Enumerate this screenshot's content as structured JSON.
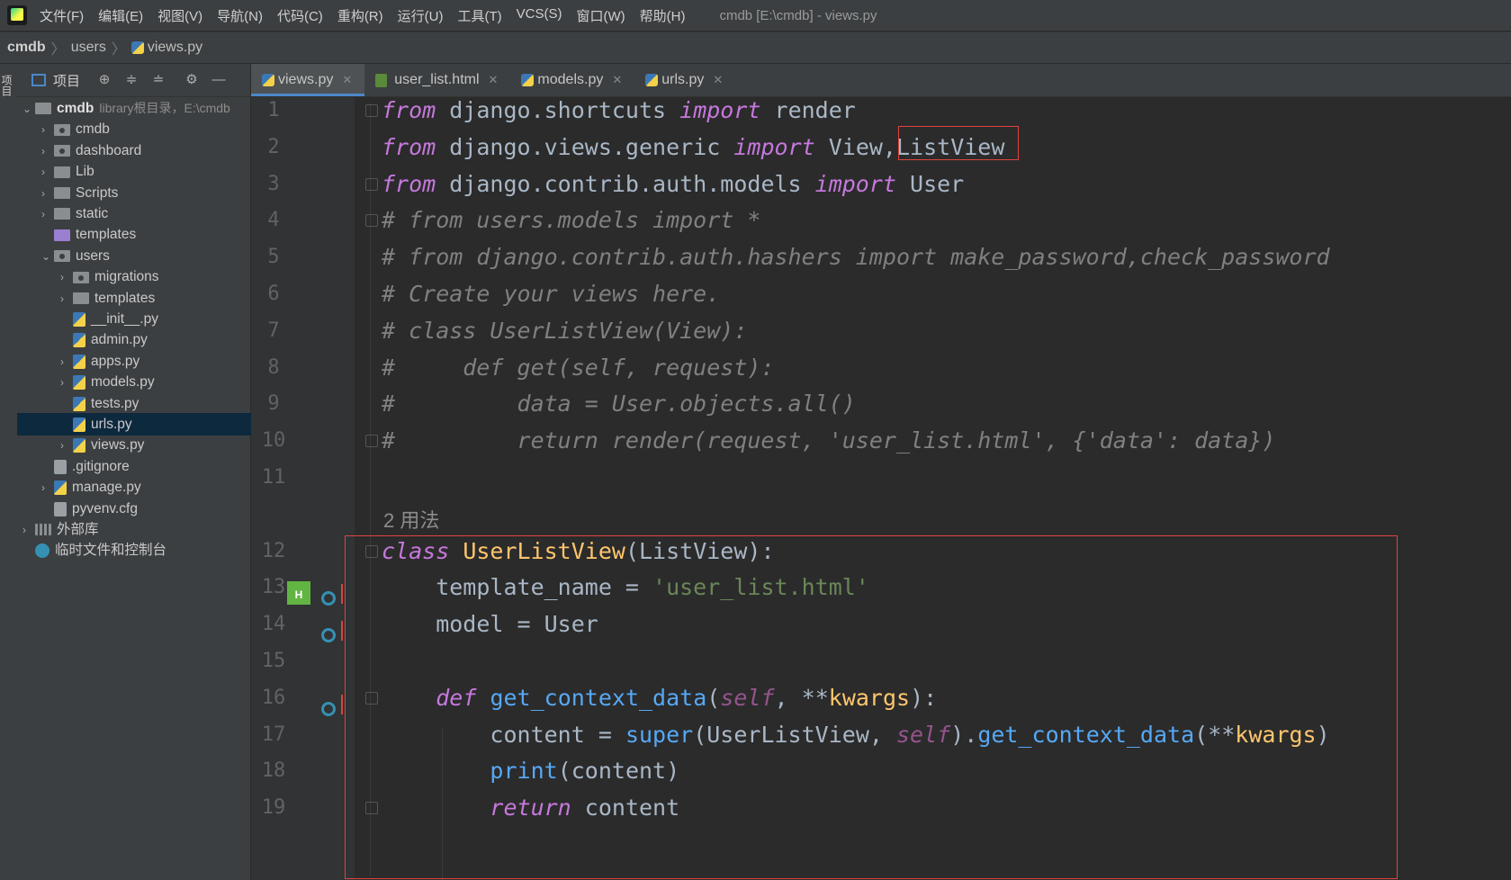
{
  "menubar": {
    "items": [
      "文件(F)",
      "编辑(E)",
      "视图(V)",
      "导航(N)",
      "代码(C)",
      "重构(R)",
      "运行(U)",
      "工具(T)",
      "VCS(S)",
      "窗口(W)",
      "帮助(H)"
    ],
    "window_title": "cmdb [E:\\cmdb] - views.py"
  },
  "breadcrumb": [
    "cmdb",
    "users",
    "views.py"
  ],
  "left_strip_label": "项目",
  "project_panel": {
    "title": "项目",
    "tree": [
      {
        "label": "cmdb",
        "extra": "library根目录，E:\\cmdb",
        "indent": 0,
        "arrow": "open",
        "icon": "folder"
      },
      {
        "label": "cmdb",
        "indent": 1,
        "arrow": "closed",
        "icon": "folder-mod"
      },
      {
        "label": "dashboard",
        "indent": 1,
        "arrow": "closed",
        "icon": "folder-mod"
      },
      {
        "label": "Lib",
        "indent": 1,
        "arrow": "closed",
        "icon": "folder"
      },
      {
        "label": "Scripts",
        "indent": 1,
        "arrow": "closed",
        "icon": "folder"
      },
      {
        "label": "static",
        "indent": 1,
        "arrow": "closed",
        "icon": "folder"
      },
      {
        "label": "templates",
        "indent": 1,
        "arrow": "none",
        "icon": "folder-purple"
      },
      {
        "label": "users",
        "indent": 1,
        "arrow": "open",
        "icon": "folder-mod"
      },
      {
        "label": "migrations",
        "indent": 2,
        "arrow": "closed",
        "icon": "folder-mod"
      },
      {
        "label": "templates",
        "indent": 2,
        "arrow": "closed",
        "icon": "folder"
      },
      {
        "label": "__init__.py",
        "indent": 2,
        "arrow": "none",
        "icon": "py"
      },
      {
        "label": "admin.py",
        "indent": 2,
        "arrow": "none",
        "icon": "py"
      },
      {
        "label": "apps.py",
        "indent": 2,
        "arrow": "closed",
        "icon": "py"
      },
      {
        "label": "models.py",
        "indent": 2,
        "arrow": "closed",
        "icon": "py"
      },
      {
        "label": "tests.py",
        "indent": 2,
        "arrow": "none",
        "icon": "py"
      },
      {
        "label": "urls.py",
        "indent": 2,
        "arrow": "none",
        "icon": "py",
        "selected": true
      },
      {
        "label": "views.py",
        "indent": 2,
        "arrow": "closed",
        "icon": "py"
      },
      {
        "label": ".gitignore",
        "indent": 1,
        "arrow": "none",
        "icon": "txt"
      },
      {
        "label": "manage.py",
        "indent": 1,
        "arrow": "closed",
        "icon": "py"
      },
      {
        "label": "pyvenv.cfg",
        "indent": 1,
        "arrow": "none",
        "icon": "txt"
      },
      {
        "label": "外部库",
        "indent": 0,
        "arrow": "closed",
        "icon": "lib"
      },
      {
        "label": "临时文件和控制台",
        "indent": 0,
        "arrow": "none",
        "icon": "scratch"
      }
    ]
  },
  "tabs": [
    {
      "label": "views.py",
      "type": "py",
      "active": true
    },
    {
      "label": "user_list.html",
      "type": "html",
      "active": false
    },
    {
      "label": "models.py",
      "type": "py",
      "active": false
    },
    {
      "label": "urls.py",
      "type": "py",
      "active": false
    }
  ],
  "editor": {
    "line_numbers": [
      "1",
      "2",
      "3",
      "4",
      "5",
      "6",
      "7",
      "8",
      "9",
      "10",
      "11",
      "12",
      "13",
      "14",
      "15",
      "16",
      "17",
      "18",
      "19"
    ],
    "usage_hint": "2 用法",
    "code": {
      "l1": [
        "from",
        " django.shortcuts ",
        "import",
        " render"
      ],
      "l2": [
        "from",
        " django.views.generic ",
        "import",
        " View,",
        "ListView"
      ],
      "l3": [
        "from",
        " django.contrib.auth.models ",
        "import",
        " User"
      ],
      "l4": "# from users.models import *",
      "l5": "# from django.contrib.auth.hashers import make_password,check_password",
      "l6": "# Create your views here.",
      "l7": "# class UserListView(View):",
      "l8": "#     def get(self, request):",
      "l9": "#         data = User.objects.all()",
      "l10": "#         return render(request, 'user_list.html', {'data': data})",
      "l12": [
        "class",
        " ",
        "UserListView",
        "(ListView):"
      ],
      "l13": [
        "    template_name = ",
        "'user_list.html'"
      ],
      "l14": "    model = User",
      "l16": [
        "    ",
        "def",
        " ",
        "get_context_data",
        "(",
        "self",
        ", **",
        "kwargs",
        "):"
      ],
      "l17": [
        "        content = ",
        "super",
        "(UserListView, ",
        "self",
        ").",
        "get_context_data",
        "(**",
        "kwargs",
        ")"
      ],
      "l18": [
        "        ",
        "print",
        "(content)"
      ],
      "l19": [
        "        ",
        "return",
        " content"
      ]
    }
  },
  "colors": {
    "keyword": "#cc7832",
    "comment": "#808080",
    "string": "#6a8759",
    "highlight_box": "#e0443e",
    "selection": "#0d293e",
    "active_tab_underline": "#4a88c7"
  }
}
